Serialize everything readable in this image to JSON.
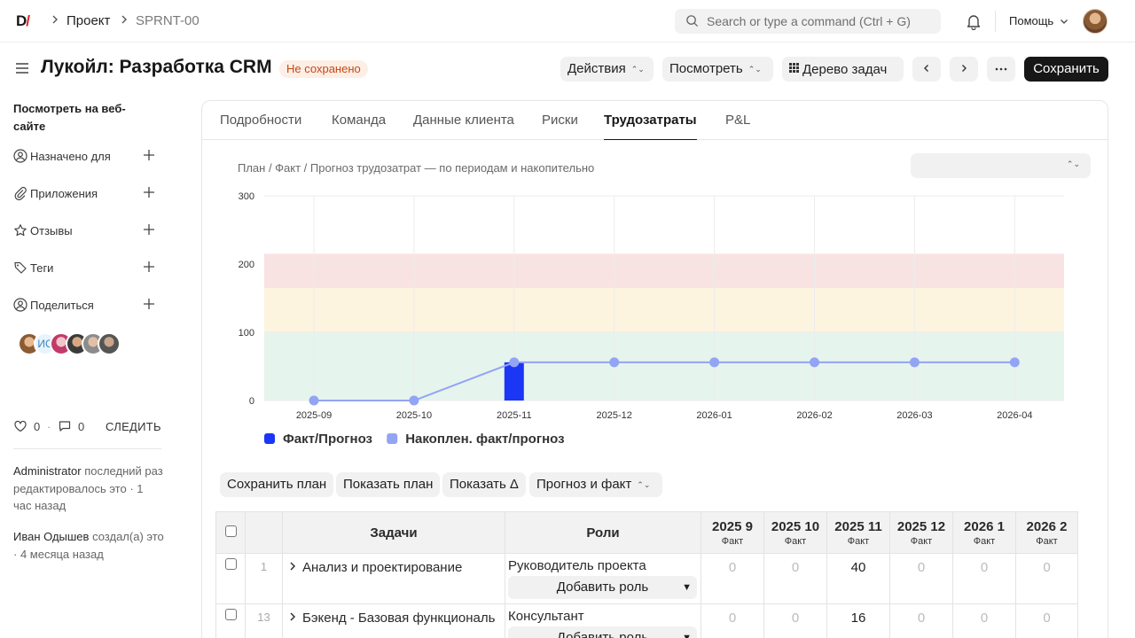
{
  "topbar": {
    "logo_d": "D",
    "logo_slash": "/",
    "breadcrumb": [
      "Проект",
      "SPRNT-00"
    ],
    "search_placeholder": "Search or type a command (Ctrl + G)",
    "help_label": "Помощь",
    "icons": {
      "search": "search-icon",
      "bell": "bell-icon",
      "chevron": "chevron-down-icon"
    }
  },
  "header": {
    "title": "Лукойл: Разработка CRM",
    "status_badge": "Не сохранено",
    "actions_label": "Действия",
    "view_label": "Посмотреть",
    "tree_label": "Дерево задач",
    "save_label": "Сохранить"
  },
  "sidebar": {
    "website_link": "Посмотреть на веб-сайте",
    "items": [
      {
        "label": "Назначено для",
        "icon": "user-circle-icon"
      },
      {
        "label": "Приложения",
        "icon": "paperclip-icon"
      },
      {
        "label": "Отзывы",
        "icon": "star-icon"
      },
      {
        "label": "Теги",
        "icon": "tag-icon"
      },
      {
        "label": "Поделиться",
        "icon": "user-circle-icon"
      }
    ],
    "avatar_initials": "ИС",
    "likes_count": "0",
    "comments_count": "0",
    "follow_label": "СЛЕДИТЬ",
    "activity": [
      {
        "user": "Administrator",
        "text": "последний раз редактировалось это · 1 час назад"
      },
      {
        "user": "Иван Одышев",
        "text": "создал(а) это · 4 месяца назад"
      }
    ]
  },
  "tabs": [
    "Подробности",
    "Команда",
    "Данные клиента",
    "Риски",
    "Трудозатраты",
    "P&L"
  ],
  "active_tab": "Трудозатраты",
  "chart_title": "План / Факт / Прогноз трудозатрат — по периодам и накопительно",
  "chart_select_value": "",
  "chart_data": {
    "type": "bar",
    "categories": [
      "2025-09",
      "2025-10",
      "2025-11",
      "2025-12",
      "2026-01",
      "2026-02",
      "2026-03",
      "2026-04"
    ],
    "ylim": [
      0,
      300
    ],
    "yticks": [
      0,
      100,
      200,
      300
    ],
    "bands": [
      {
        "from": 0,
        "to": 100,
        "color": "#e6f4ee"
      },
      {
        "from": 100,
        "to": 165,
        "color": "#fdf4df"
      },
      {
        "from": 165,
        "to": 215,
        "color": "#f9e2e2"
      }
    ],
    "series": [
      {
        "name": "Факт/Прогноз",
        "kind": "bar",
        "color": "#1b36f5",
        "values": [
          0,
          0,
          56,
          0,
          0,
          0,
          0,
          0
        ]
      },
      {
        "name": "Накоплен. факт/прогноз",
        "kind": "line",
        "color": "#93a4f4",
        "values": [
          0,
          0,
          56,
          56,
          56,
          56,
          56,
          56
        ]
      }
    ],
    "legend_position": "bottom-left",
    "grid": true
  },
  "table_actions": {
    "save_plan": "Сохранить план",
    "show_plan": "Показать план",
    "show_delta": "Показать Δ",
    "mode": "Прогноз и факт"
  },
  "table": {
    "headers": {
      "tasks": "Задачи",
      "roles": "Роли"
    },
    "periods": [
      {
        "label": "2025 9",
        "sub": "Факт"
      },
      {
        "label": "2025 10",
        "sub": "Факт"
      },
      {
        "label": "2025 11",
        "sub": "Факт"
      },
      {
        "label": "2025 12",
        "sub": "Факт"
      },
      {
        "label": "2026 1",
        "sub": "Факт"
      },
      {
        "label": "2026 2",
        "sub": "Факт"
      }
    ],
    "add_role_label": "Добавить роль",
    "rows": [
      {
        "index": "1",
        "task": "Анализ и проектирование",
        "role": "Руководитель проекта",
        "values": [
          "0",
          "0",
          "40",
          "0",
          "0",
          "0"
        ]
      },
      {
        "index": "13",
        "task": "Бэкенд - Базовая функциональ",
        "role": "Консультант",
        "values": [
          "0",
          "0",
          "16",
          "0",
          "0",
          "0"
        ]
      }
    ]
  }
}
